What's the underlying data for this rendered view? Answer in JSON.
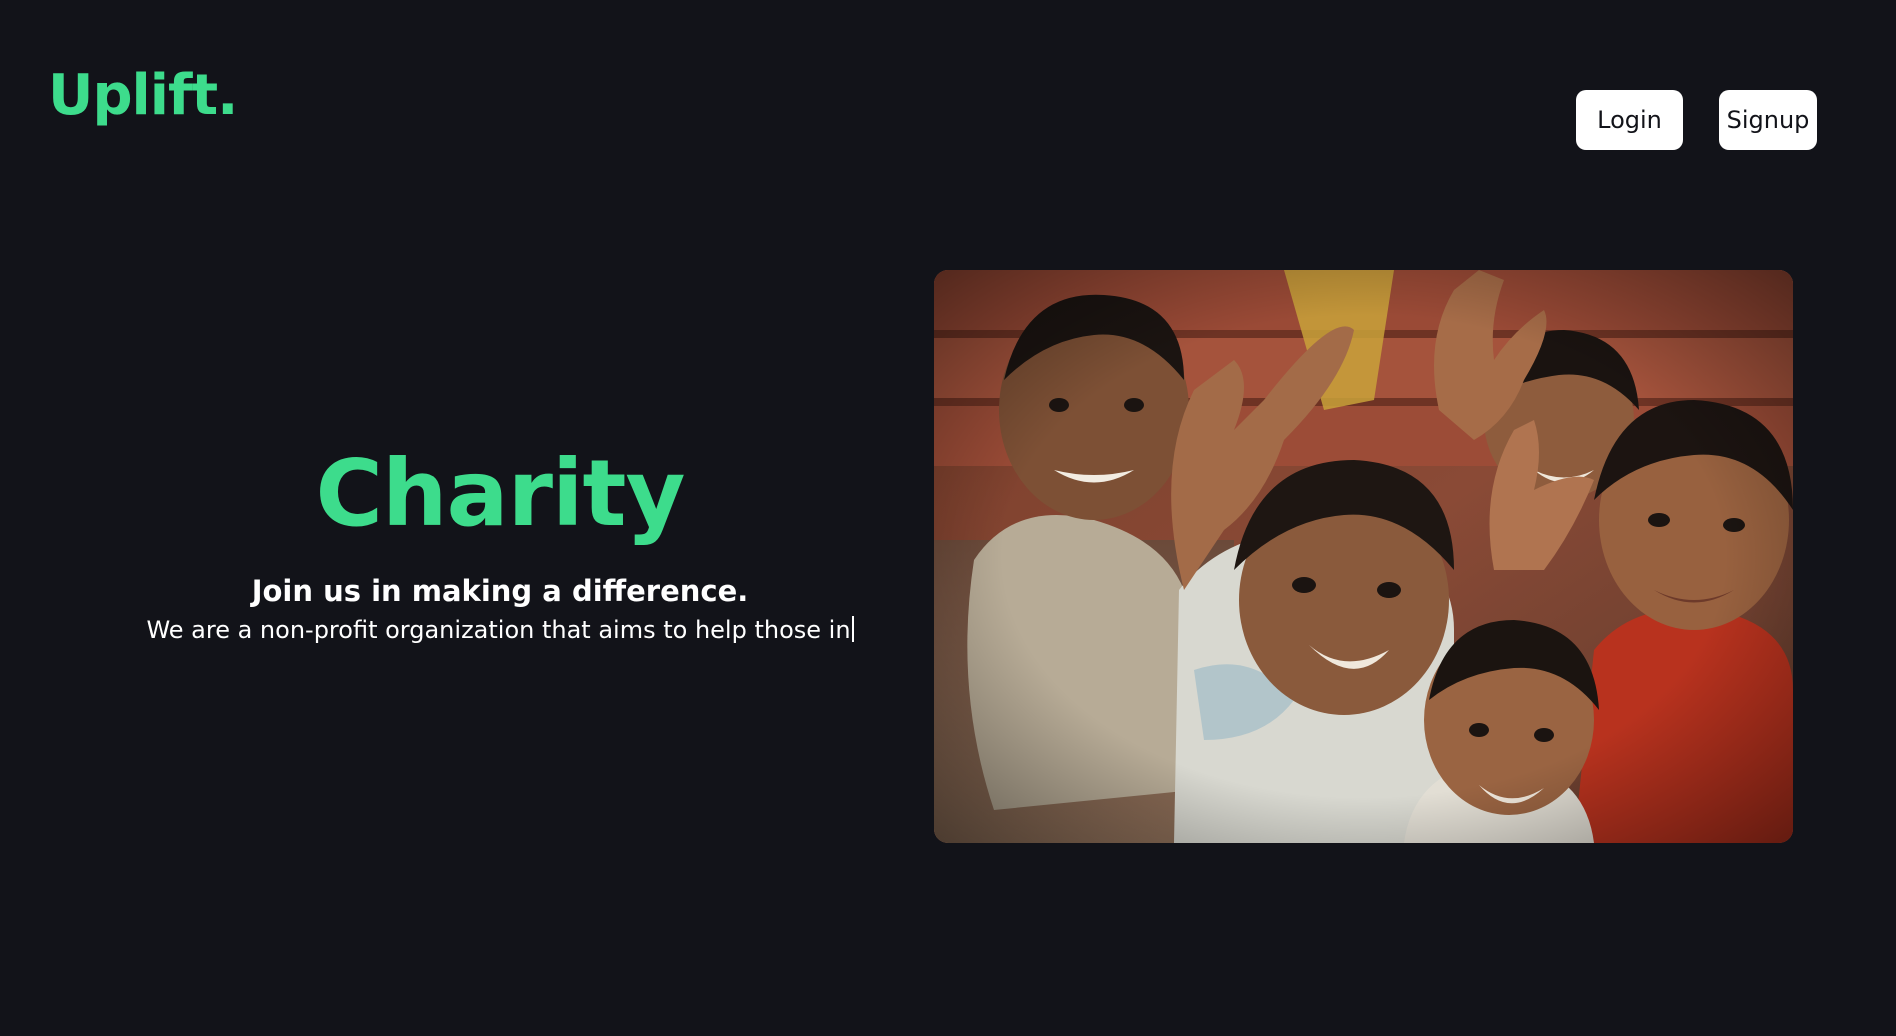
{
  "brand": {
    "logo": "Uplift.",
    "accent_color": "#3ddc8c",
    "background_color": "#121319"
  },
  "nav": {
    "login_label": "Login",
    "signup_label": "Signup"
  },
  "hero": {
    "title": "Charity",
    "subtitle": "Join us in making a difference.",
    "description": "We are a non-profit organization that aims to help those in"
  },
  "image": {
    "icon": "photo-children-smiling"
  }
}
